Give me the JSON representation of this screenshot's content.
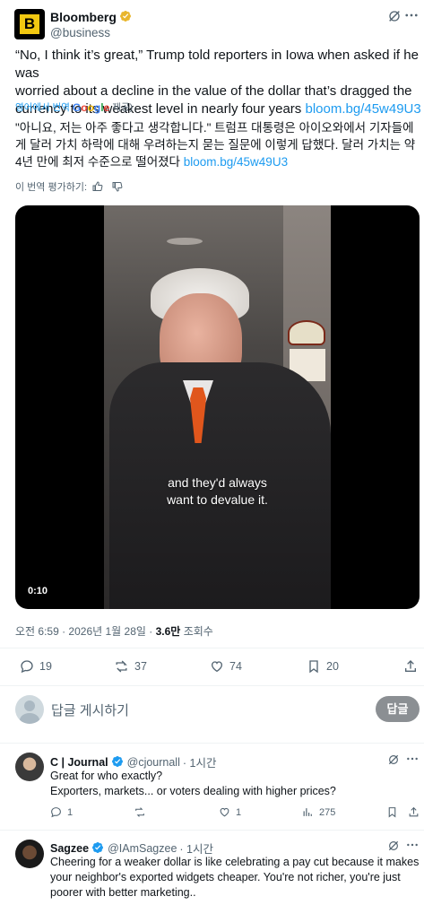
{
  "post": {
    "author_name": "Bloomberg",
    "author_handle": "@business",
    "text_line1": "“No, I think it’s great,” Trump told reporters in Iowa when asked if he was",
    "text_line2": "worried about a decline in the value of the dollar that’s dragged the",
    "text_line3": "currency to its weakest level in nearly four years",
    "link": "bloom.bg/45w49U3",
    "translated_from": "영어에서 번역",
    "google": "Google",
    "provided": "제공)",
    "translation_line1": "\"아니요, 저는 아주 좋다고 생각합니다.\" 트럼프 대통령은 아이오와에서 기자들에",
    "translation_line2": "게 달러 가치 하락에 대해 우려하는지 묻는 질문에 이렇게 답했다. 달러 가치는 약",
    "translation_line3": "4년 만에 최저 수준으로 떨어졌다",
    "translation_link": "bloom.bg/45w49U3",
    "rate_translation": "이 번역 평가하기:",
    "video_caption_line1": "and they'd always",
    "video_caption_line2": "want to devalue it.",
    "video_time": "0:10",
    "timestamp": "오전 6:59 · 2026년 1월 28일 ·",
    "views_count": "3.6만",
    "views_label": "조회수",
    "stats": {
      "replies": "19",
      "reposts": "37",
      "likes": "74",
      "bookmarks": "20"
    }
  },
  "composer": {
    "placeholder": "답글 게시하기",
    "button": "답글"
  },
  "replies": [
    {
      "name": "C | Journal",
      "handle": "@cjournall",
      "time": "· 1시간",
      "line1": "Great for who exactly?",
      "line2": "Exporters, markets... or voters dealing with higher prices?",
      "replies": "1",
      "reposts": "",
      "likes": "1",
      "views": "275"
    },
    {
      "name": "Sagzee",
      "handle": "@IAmSagzee",
      "time": "· 1시간",
      "line1": "Cheering for a weaker dollar is like celebrating a pay cut because it makes",
      "line2": "your neighbor's exported widgets cheaper. You're not richer, you're just",
      "line3": "poorer with better marketing.."
    }
  ],
  "colors": {
    "accent": "#1d9bf0",
    "verified": "#e8b52c",
    "muted": "#536471"
  }
}
